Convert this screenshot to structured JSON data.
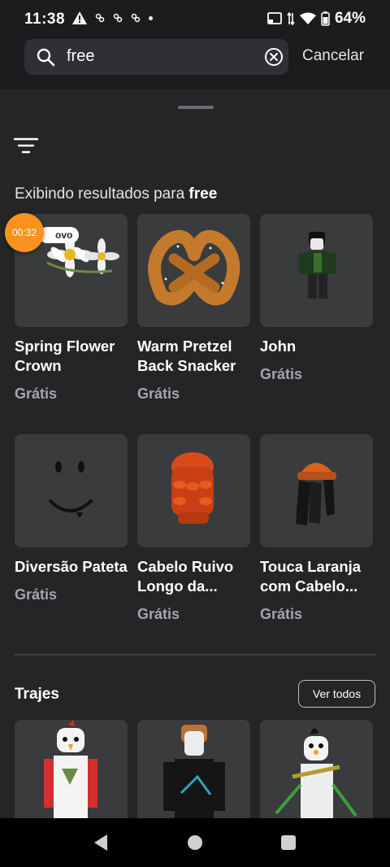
{
  "status_bar": {
    "time": "11:38",
    "battery": "64%",
    "icons": [
      "warning-icon",
      "notification-icon",
      "cast-icon",
      "wifi-icon",
      "battery-icon"
    ]
  },
  "search": {
    "value": "free",
    "placeholder": "",
    "cancel_label": "Cancelar"
  },
  "results": {
    "prefix": "Exibindo resultados para ",
    "query": "free"
  },
  "items": [
    {
      "name": "Spring Flower Crown",
      "price": "Grátis",
      "badge": "ovo"
    },
    {
      "name": "Warm Pretzel Back Snacker",
      "price": "Grátis"
    },
    {
      "name": "John",
      "price": "Grátis"
    },
    {
      "name": "Diversão Pateta",
      "price": "Grátis"
    },
    {
      "name": "Cabelo Ruivo Longo da...",
      "price": "Grátis"
    },
    {
      "name": "Touca Laranja com Cabelo...",
      "price": "Grátis"
    }
  ],
  "timer": "00:32",
  "outfits_section": {
    "title": "Trajes",
    "see_all_label": "Ver todos"
  },
  "colors": {
    "background": "#232527",
    "card": "#393b3d",
    "accent_orange": "#f7931e"
  }
}
